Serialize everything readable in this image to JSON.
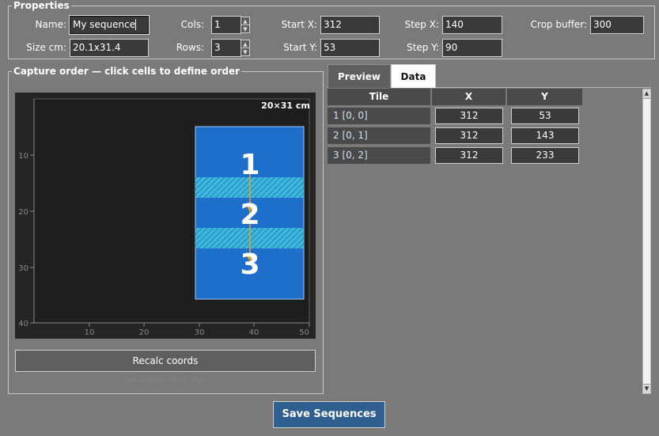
{
  "properties": {
    "title": "Properties",
    "name_label": "Name:",
    "name_value": "My sequence",
    "cols_label": "Cols:",
    "cols_value": "1",
    "startx_label": "Start X:",
    "startx_value": "312",
    "stepx_label": "Step X:",
    "stepx_value": "140",
    "crop_label": "Crop buffer:",
    "crop_value": "300",
    "size_label": "Size cm:",
    "size_value": "20.1x31.4",
    "rows_label": "Rows:",
    "rows_value": "3",
    "starty_label": "Start Y:",
    "starty_value": "53",
    "stepy_label": "Step Y:",
    "stepy_value": "90"
  },
  "capture": {
    "title": "Capture order  —  click cells to define order",
    "dims_label": "20×31 cm",
    "y_ticks": [
      "10",
      "20",
      "30",
      "40"
    ],
    "x_ticks": [
      "10",
      "20",
      "30",
      "40",
      "50"
    ],
    "order_numbers": [
      "1",
      "2",
      "3"
    ],
    "recalc_label": "Recalc coords",
    "hint": "Left-drag to offset view"
  },
  "tabs": [
    {
      "label": "Preview",
      "active": false
    },
    {
      "label": "Data",
      "active": true
    }
  ],
  "table": {
    "headers": [
      "Tile",
      "X",
      "Y"
    ],
    "rows": [
      {
        "tile": "1  [0, 0]",
        "x": "312",
        "y": "53"
      },
      {
        "tile": "2  [0, 1]",
        "x": "312",
        "y": "143"
      },
      {
        "tile": "3  [0, 2]",
        "x": "312",
        "y": "233"
      }
    ]
  },
  "footer": {
    "save_label": "Save Sequences"
  },
  "colors": {
    "background": "#7a7a7a",
    "tile_blue": "#1e6fcc",
    "overlap": "#36b6d6",
    "path": "#e2a21a",
    "save_button": "#2f5f8f"
  }
}
